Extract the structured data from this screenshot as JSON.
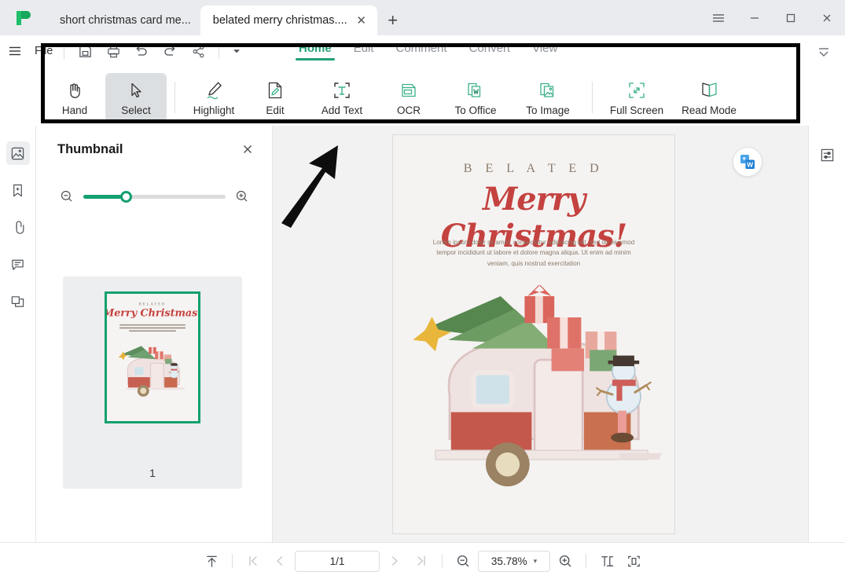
{
  "window": {
    "controls": [
      "menu-icon",
      "minimize-icon",
      "maximize-icon",
      "close-icon"
    ]
  },
  "tabs": {
    "items": [
      {
        "label": "short christmas card me...",
        "active": false
      },
      {
        "label": "belated merry christmas....",
        "active": true
      }
    ],
    "new_tab_label": "+",
    "close_label": "✕"
  },
  "menu": {
    "file_label": "File",
    "quick_access": [
      "save-icon",
      "print-icon",
      "undo-icon",
      "redo-icon",
      "share-icon"
    ],
    "caret_label": "▾"
  },
  "ribbon": {
    "tabs": [
      {
        "label": "Home",
        "selected": true
      },
      {
        "label": "Edit",
        "selected": false
      },
      {
        "label": "Comment",
        "selected": false
      },
      {
        "label": "Convert",
        "selected": false
      },
      {
        "label": "View",
        "selected": false
      }
    ]
  },
  "toolbar": {
    "tools": [
      {
        "label": "Hand",
        "icon": "hand-icon",
        "active": false
      },
      {
        "label": "Select",
        "icon": "cursor-arrow-icon",
        "active": true
      },
      {
        "label": "Highlight",
        "icon": "highlighter-pen-icon",
        "active": false
      },
      {
        "label": "Edit",
        "icon": "edit-document-icon",
        "active": false
      },
      {
        "label": "Add Text",
        "icon": "add-text-icon",
        "active": false
      },
      {
        "label": "OCR",
        "icon": "ocr-icon",
        "active": false
      },
      {
        "label": "To Office",
        "icon": "to-word-icon",
        "active": false
      },
      {
        "label": "To Image",
        "icon": "to-image-icon",
        "active": false
      },
      {
        "label": "Full Screen",
        "icon": "fullscreen-icon",
        "active": false
      },
      {
        "label": "Read Mode",
        "icon": "book-open-icon",
        "active": false
      }
    ]
  },
  "left_rail": {
    "items": [
      {
        "name": "thumbnail-panel",
        "icon": "thumbnail-icon",
        "selected": true
      },
      {
        "name": "bookmark-panel",
        "icon": "bookmark-add-icon",
        "selected": false
      },
      {
        "name": "attachment-panel",
        "icon": "paperclip-icon",
        "selected": false
      },
      {
        "name": "comment-panel",
        "icon": "comment-icon",
        "selected": false
      },
      {
        "name": "layers-panel",
        "icon": "layers-icon",
        "selected": false
      }
    ]
  },
  "thumbnail_panel": {
    "title": "Thumbnail",
    "close_label": "✕",
    "zoom_out_icon": "zoom-out-icon",
    "zoom_in_icon": "zoom-in-icon",
    "slider_value": 26,
    "page_number": "1"
  },
  "document": {
    "card": {
      "eyebrow": "B E L A T E D",
      "headline": "Merry Christmas!",
      "body": "Lorem ipsum dolor sit amet, consectetur adipiscing elit, sed do eiusmod tempor incididunt ut labore et dolore magna aliqua. Ut enim ad minim veniam, quis nostrud exercitation",
      "illustration": "watercolor-caravan-christmas-tree-gifts-snowman"
    },
    "floating_convert_icon": "pdf-to-word-icon"
  },
  "right_rail": {
    "items": [
      {
        "name": "properties-panel",
        "icon": "sliders-icon"
      }
    ]
  },
  "status_bar": {
    "scroll_top_icon": "scroll-to-top-icon",
    "first_page_icon": "first-page-icon",
    "prev_page_icon": "prev-page-icon",
    "page_indicator": "1/1",
    "next_page_icon": "next-page-icon",
    "last_page_icon": "last-page-icon",
    "zoom_out_icon": "zoom-out-icon",
    "zoom_level": "35.78%",
    "zoom_caret": "▾",
    "zoom_in_icon": "zoom-in-icon",
    "fit_page_icon": "fit-page-icon",
    "fit_width_icon": "fit-width-icon"
  },
  "annotations": {
    "rectangle": "black-highlight-rectangle-around-toolbar",
    "arrow": "black-arrow-pointing-to-toolbar"
  },
  "colors": {
    "accent": "#22a07a",
    "slider": "#13a06e",
    "tabbar_bg": "#e9ebee",
    "doc_bg": "#f2f2f2",
    "card_red": "#c4423f",
    "card_tan": "#8a7a6b"
  }
}
